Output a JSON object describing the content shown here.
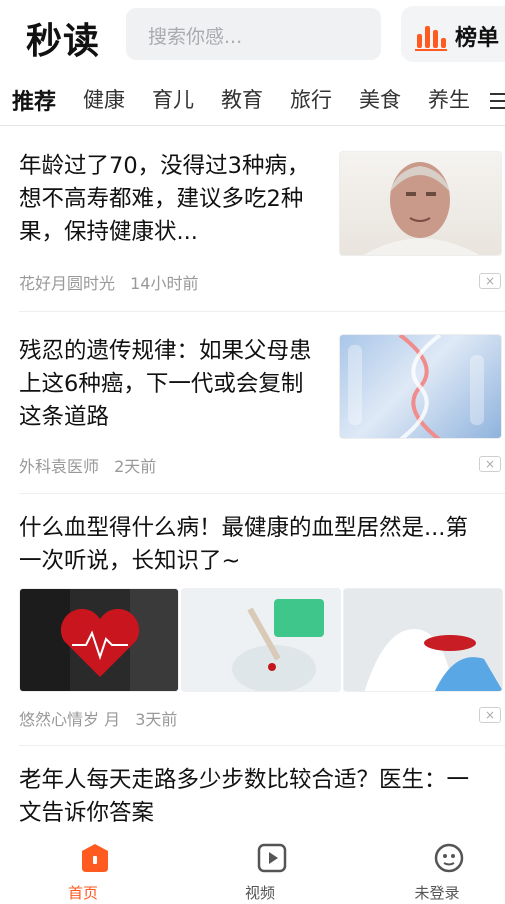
{
  "header": {
    "logo": "秒读",
    "search_placeholder": "搜索你感...",
    "rank_label": "榜单"
  },
  "tabs": [
    "推荐",
    "健康",
    "育儿",
    "教育",
    "旅行",
    "美食",
    "养生"
  ],
  "feed": [
    {
      "title": "年龄过了70，没得过3种病，想不高寿都难，建议多吃2种果，保持健康状...",
      "source": "花好月圆时光",
      "time": "14小时前"
    },
    {
      "title": "残忍的遗传规律：如果父母患上这6种癌，下一代或会复制这条道路",
      "source": "外科袁医师",
      "time": "2天前"
    },
    {
      "title": "什么血型得什么病！最健康的血型居然是...第一次听说，长知识了~",
      "source": "悠然心情岁 月",
      "time": "3天前"
    },
    {
      "title": "老年人每天走路多少步数比较合适？医生：一文告诉你答案"
    }
  ],
  "close_glyph": "×",
  "bottom_nav": {
    "home": "首页",
    "video": "视频",
    "login": "未登录"
  },
  "colors": {
    "accent": "#ff5a1f"
  }
}
